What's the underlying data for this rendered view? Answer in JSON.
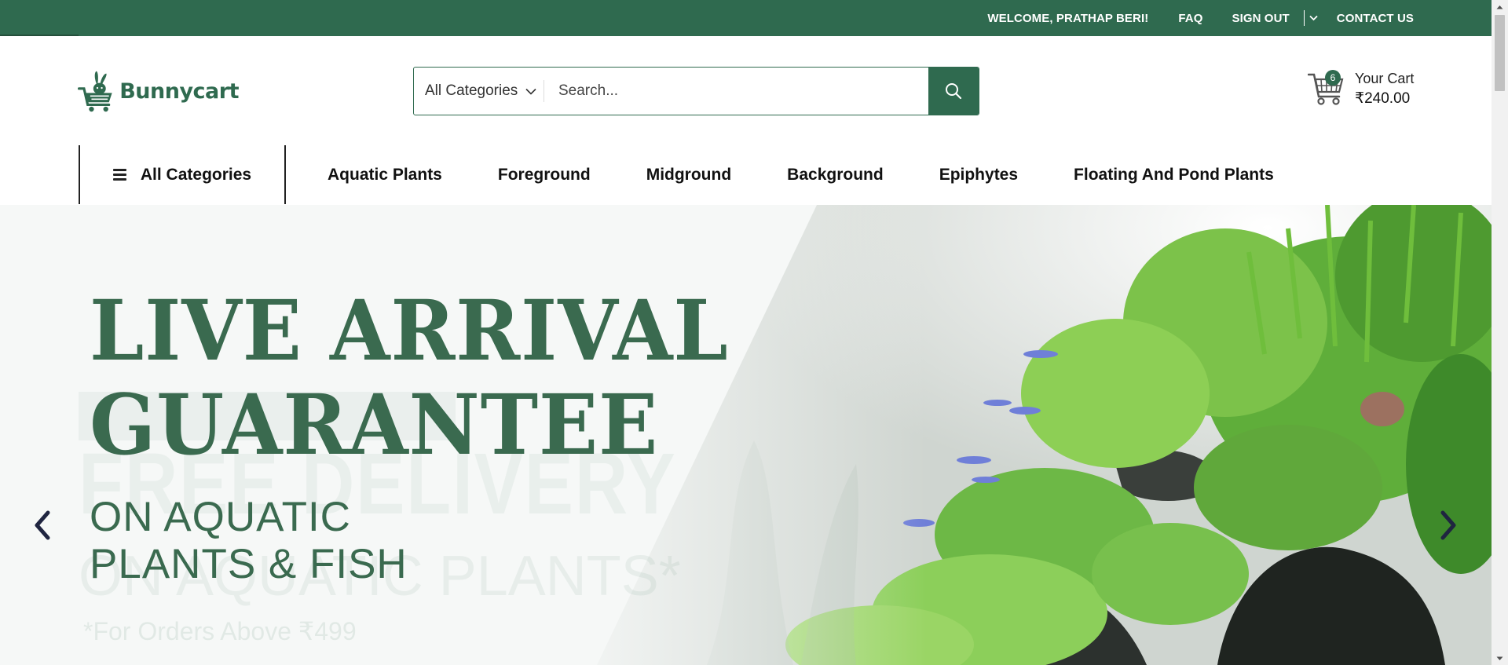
{
  "topbar": {
    "welcome": "WELCOME, PRATHAP BERI!",
    "faq": "FAQ",
    "sign_out": "SIGN OUT",
    "contact": "CONTACT US",
    "accent_color": "#2f6a4f"
  },
  "header": {
    "logo_text": "Bunnycart",
    "search": {
      "category": "All Categories",
      "placeholder": "Search...",
      "button_icon": "search-icon"
    },
    "cart": {
      "count": "6",
      "label": "Your Cart",
      "total": "₹240.00",
      "icon": "cart-icon"
    }
  },
  "nav": {
    "all_categories": "All Categories",
    "items": [
      {
        "label": "Aquatic Plants"
      },
      {
        "label": "Foreground"
      },
      {
        "label": "Midground"
      },
      {
        "label": "Background"
      },
      {
        "label": "Epiphytes"
      },
      {
        "label": "Floating And Pond Plants"
      }
    ]
  },
  "hero": {
    "headline_line1": "LIVE ARRIVAL",
    "headline_line2": "GUARANTEE",
    "sub_line1": "ON AQUATIC",
    "sub_line2": "PLANTS & FISH",
    "ghost_free": "FREE DELIVERY",
    "ghost_plants": "ON AQUATIC PLANTS*",
    "ghost_orders": "*For Orders Above ₹499",
    "prev_icon": "chevron-left-icon",
    "next_icon": "chevron-right-icon"
  }
}
